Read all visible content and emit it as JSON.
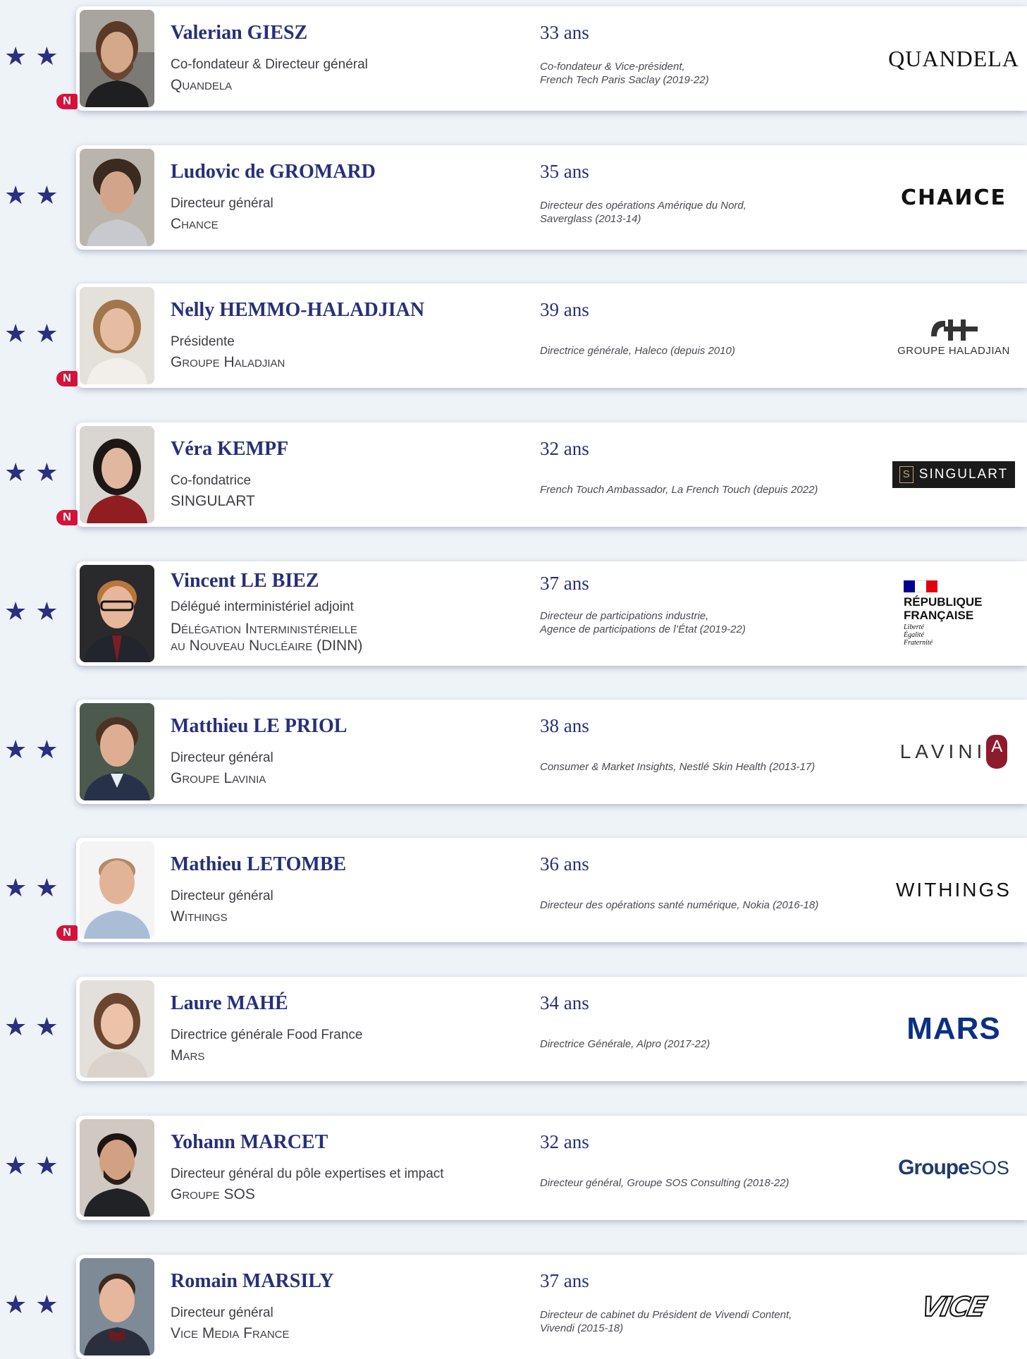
{
  "stars": "★★",
  "badge_label": "N",
  "entries": [
    {
      "name": "Valerian GIESZ",
      "role": "Co-fondateur & Directeur général",
      "company": "Quandela",
      "age": "33 ans",
      "previous": [
        "Co-fondateur & Vice-président,",
        "French Tech Paris Saclay (2019-22)"
      ],
      "logo": "QUANDELA",
      "new": true
    },
    {
      "name": "Ludovic de GROMARD",
      "role": "Directeur général",
      "company": "Chance",
      "age": "35 ans",
      "previous": [
        "Directeur des opérations Amérique du Nord,",
        "Saverglass (2013-14)"
      ],
      "logo": "CHAИCE",
      "new": false
    },
    {
      "name": "Nelly HEMMO-HALADJIAN",
      "role": "Présidente",
      "company": "Groupe Haladjian",
      "age": "39 ans",
      "previous": [
        "Directrice générale, Haleco (depuis 2010)"
      ],
      "logo": "GROUPE HALADJIAN",
      "new": true
    },
    {
      "name": "Véra KEMPF",
      "role": "Co-fondatrice",
      "company": "SINGULART",
      "age": "32 ans",
      "previous": [
        "French Touch Ambassador, La French Touch (depuis 2022)"
      ],
      "logo": "SINGULART",
      "new": true
    },
    {
      "name": "Vincent LE BIEZ",
      "role": "Délégué interministériel adjoint",
      "company": "Délégation Interministérielle",
      "company2": "au Nouveau Nucléaire (DINN)",
      "age": "37 ans",
      "previous": [
        "Directeur de participations industrie,",
        "Agence de participations de l’État (2019-22)"
      ],
      "logo": "RÉPUBLIQUE FRANÇAISE",
      "logo_motto": [
        "Liberté",
        "Égalité",
        "Fraternité"
      ],
      "new": false
    },
    {
      "name": "Matthieu LE PRIOL",
      "role": "Directeur général",
      "company": "Groupe Lavinia",
      "age": "38 ans",
      "previous": [
        "Consumer & Market Insights, Nestlé Skin Health (2013-17)"
      ],
      "logo": "LAVINI",
      "logo_mark": "A",
      "new": false
    },
    {
      "name": "Mathieu LETOMBE",
      "role": "Directeur général",
      "company": "Withings",
      "age": "36 ans",
      "previous": [
        "Directeur des opérations santé numérique, Nokia (2016-18)"
      ],
      "logo": "WITHINGS",
      "new": true
    },
    {
      "name": "Laure MAHÉ",
      "role": "Directrice générale Food France",
      "company": "Mars",
      "age": "34 ans",
      "previous": [
        "Directrice Générale, Alpro (2017-22)"
      ],
      "logo": "MARS",
      "new": false
    },
    {
      "name": "Yohann MARCET",
      "role": "Directeur général du pôle expertises et impact",
      "company": "Groupe SOS",
      "age": "32 ans",
      "previous": [
        "Directeur général, Groupe SOS Consulting (2018-22)"
      ],
      "logo": "Groupe",
      "logo_suffix": "SOS",
      "new": false
    },
    {
      "name": "Romain MARSILY",
      "role": "Directeur général",
      "company": "Vice Media France",
      "age": "37 ans",
      "previous": [
        "Directeur de cabinet du Président de Vivendi Content,",
        "Vivendi (2015-18)"
      ],
      "logo": "VICE",
      "new": false
    }
  ]
}
